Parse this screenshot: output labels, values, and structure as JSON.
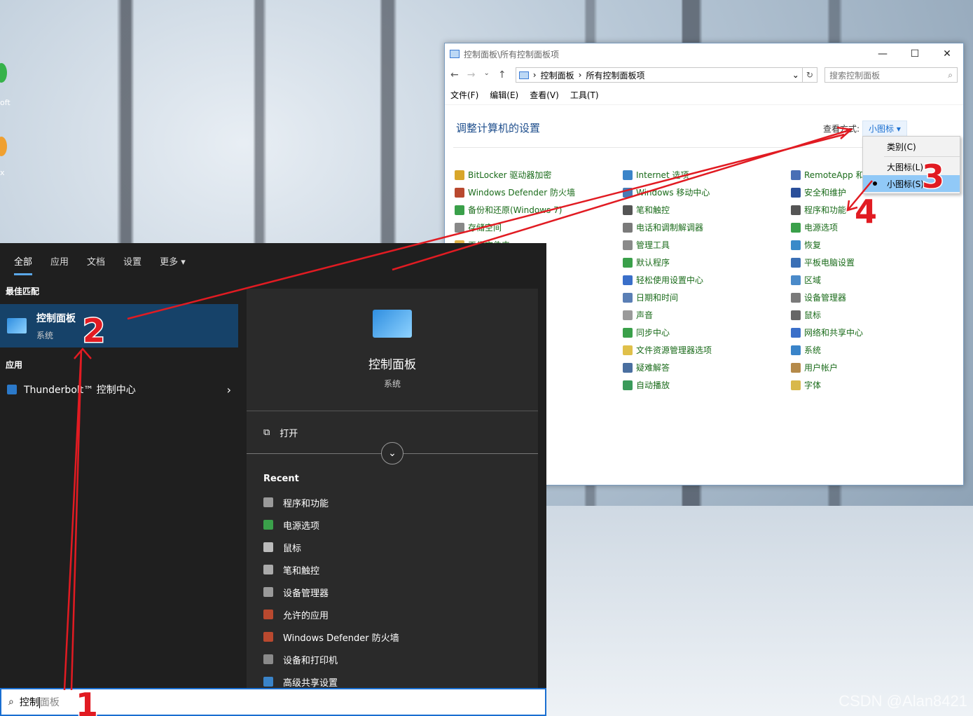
{
  "desktop": {
    "icon_fragments": [
      "oft",
      "x"
    ],
    "watermark": "CSDN @Alan8421"
  },
  "control_panel": {
    "title": "控制面板\\所有控制面板项",
    "breadcrumb": [
      "控制面板",
      "所有控制面板项"
    ],
    "search_placeholder": "搜索控制面板",
    "menu": [
      "文件(F)",
      "编辑(E)",
      "查看(V)",
      "工具(T)"
    ],
    "heading": "调整计算机的设置",
    "view_by_label": "查看方式:",
    "view_by_value": "小图标",
    "view_menu": [
      "类别(C)",
      "大图标(L)",
      "小图标(S)"
    ],
    "view_menu_selected": "小图标(S)",
    "items": [
      {
        "label": "BitLocker 驱动器加密",
        "color": "#d8a62a"
      },
      {
        "label": "Windows Defender 防火墙",
        "color": "#b9492f"
      },
      {
        "label": "备份和还原(Windows 7)",
        "color": "#3aa04a"
      },
      {
        "label": "存储空间",
        "color": "#888888"
      },
      {
        "label": "工作文件夹",
        "color": "#e0b44a"
      },
      {
        "label": "",
        "color": ""
      },
      {
        "label": "",
        "color": ""
      },
      {
        "label": "",
        "color": ""
      },
      {
        "label": "",
        "color": ""
      },
      {
        "label": "",
        "color": ""
      },
      {
        "label": "",
        "color": ""
      },
      {
        "label": "",
        "color": ""
      },
      {
        "label": "",
        "color": ""
      },
      {
        "label": "Internet 选项",
        "color": "#3a84c9"
      },
      {
        "label": "Windows 移动中心",
        "color": "#4a7bb5"
      },
      {
        "label": "笔和触控",
        "color": "#555555"
      },
      {
        "label": "电话和调制解调器",
        "color": "#7a7a7a"
      },
      {
        "label": "管理工具",
        "color": "#8a8a8a"
      },
      {
        "label": "默认程序",
        "color": "#3aa04a"
      },
      {
        "label": "轻松使用设置中心",
        "color": "#3a6fc9"
      },
      {
        "label": "日期和时间",
        "color": "#5a7fb5"
      },
      {
        "label": "声音",
        "color": "#9a9a9a"
      },
      {
        "label": "同步中心",
        "color": "#3aa04a"
      },
      {
        "label": "文件资源管理器选项",
        "color": "#e0c04a"
      },
      {
        "label": "疑难解答",
        "color": "#4a6fa0"
      },
      {
        "label": "自动播放",
        "color": "#3a9a5a"
      },
      {
        "label": "RemoteApp 和",
        "color": "#4a6fb5"
      },
      {
        "label": "安全和维护",
        "color": "#2a4f9a"
      },
      {
        "label": "程序和功能",
        "color": "#555555"
      },
      {
        "label": "电源选项",
        "color": "#3aa04a"
      },
      {
        "label": "恢复",
        "color": "#3a8ac9"
      },
      {
        "label": "平板电脑设置",
        "color": "#3a6fb5"
      },
      {
        "label": "区域",
        "color": "#4a8ac9"
      },
      {
        "label": "设备管理器",
        "color": "#7a7a7a"
      },
      {
        "label": "鼠标",
        "color": "#666666"
      },
      {
        "label": "网络和共享中心",
        "color": "#3a6fc9"
      },
      {
        "label": "系统",
        "color": "#3a84c9"
      },
      {
        "label": "用户帐户",
        "color": "#b58a4a"
      },
      {
        "label": "字体",
        "color": "#d8b84a"
      }
    ]
  },
  "start_search": {
    "tabs": [
      "全部",
      "应用",
      "文档",
      "设置",
      "更多 ▾"
    ],
    "more_icon": "···",
    "close_icon": "✕",
    "best_match_header": "最佳匹配",
    "best_match": {
      "title": "控制面板",
      "subtitle": "系统"
    },
    "apps_header": "应用",
    "apps": [
      {
        "label": "Thunderbolt™ 控制中心"
      }
    ],
    "preview": {
      "title": "控制面板",
      "subtitle": "系统",
      "open_label": "打开"
    },
    "recent_header": "Recent",
    "recent": [
      {
        "label": "程序和功能",
        "color": "#9a9a9a"
      },
      {
        "label": "电源选项",
        "color": "#3aa04a"
      },
      {
        "label": "鼠标",
        "color": "#bbbbbb"
      },
      {
        "label": "笔和触控",
        "color": "#aaaaaa"
      },
      {
        "label": "设备管理器",
        "color": "#9a9a9a"
      },
      {
        "label": "允许的应用",
        "color": "#b9492f"
      },
      {
        "label": "Windows Defender 防火墙",
        "color": "#b9492f"
      },
      {
        "label": "设备和打印机",
        "color": "#8a8a8a"
      },
      {
        "label": "高级共享设置",
        "color": "#3a84c9"
      }
    ],
    "query_typed": "控制",
    "query_ghost": "面板"
  },
  "annotations": [
    "1",
    "2",
    "3",
    "4"
  ]
}
